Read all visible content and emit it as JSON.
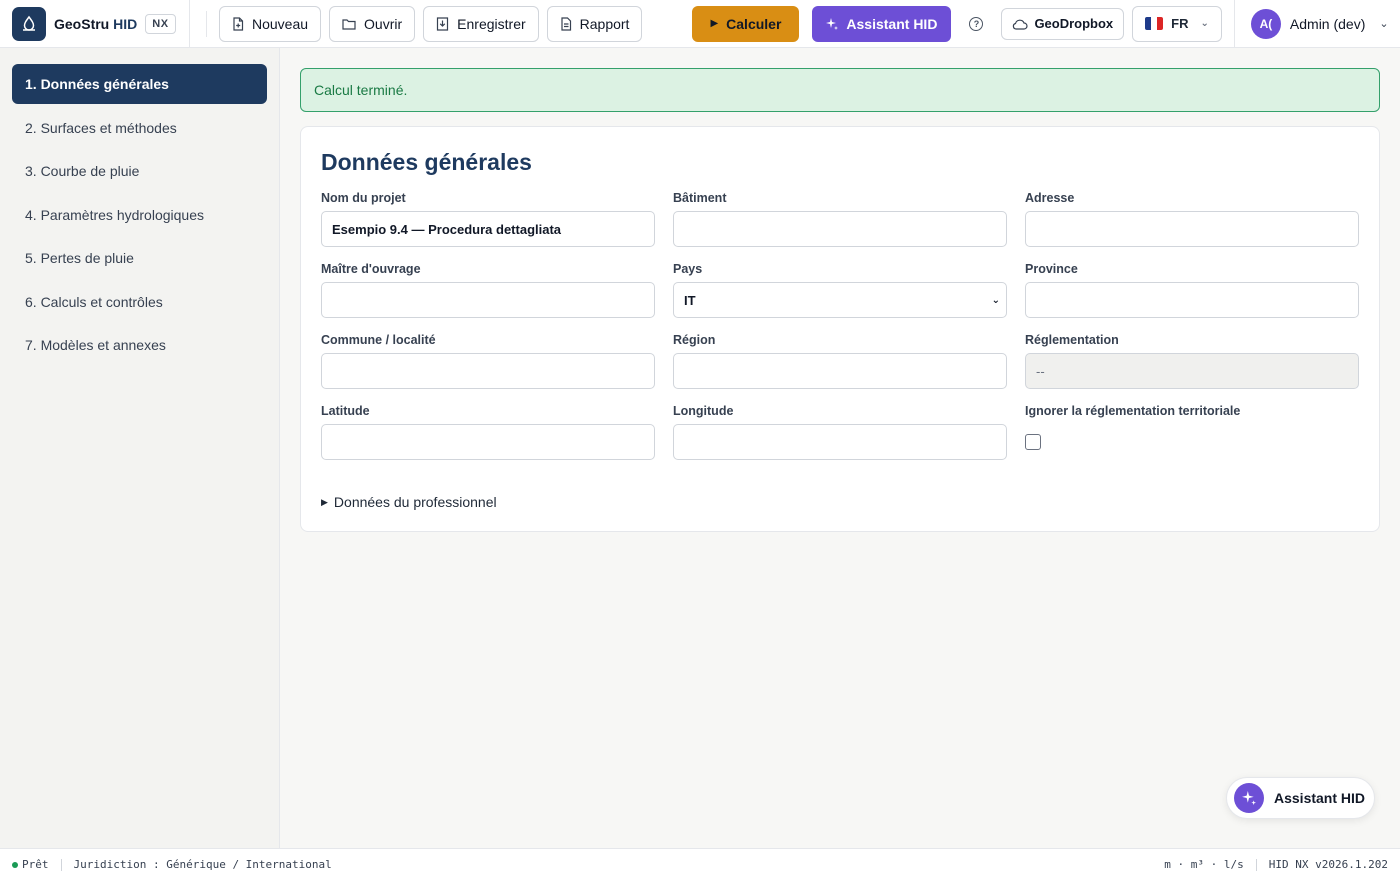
{
  "brand": {
    "name_part1": "GeoStru",
    "name_part2": "HID",
    "badge": "NX"
  },
  "toolbar": {
    "new_label": "Nouveau",
    "open_label": "Ouvrir",
    "save_label": "Enregistrer",
    "report_label": "Rapport",
    "calculate_label": "Calculer",
    "assistant_label": "Assistant HID",
    "help_label": "?",
    "dropbox_label": "GeoDropbox",
    "language": "FR",
    "user_initials": "A(",
    "user_name": "Admin (dev)"
  },
  "sidebar": {
    "items": [
      {
        "label": "1. Données générales",
        "active": true
      },
      {
        "label": "2. Surfaces et méthodes"
      },
      {
        "label": "3. Courbe de pluie"
      },
      {
        "label": "4. Paramètres hydrologiques"
      },
      {
        "label": "5. Pertes de pluie"
      },
      {
        "label": "6. Calculs et contrôles"
      },
      {
        "label": "7. Modèles et annexes"
      }
    ]
  },
  "alert": {
    "message": "Calcul terminé."
  },
  "form": {
    "title": "Données générales",
    "fields": {
      "project_name": {
        "label": "Nom du projet",
        "value": "Esempio 9.4 — Procedura dettagliata"
      },
      "building": {
        "label": "Bâtiment",
        "value": ""
      },
      "address": {
        "label": "Adresse",
        "value": ""
      },
      "client": {
        "label": "Maître d'ouvrage",
        "value": ""
      },
      "country": {
        "label": "Pays",
        "value": "IT"
      },
      "province": {
        "label": "Province",
        "value": ""
      },
      "municipality": {
        "label": "Commune / localité",
        "value": ""
      },
      "region": {
        "label": "Région",
        "value": ""
      },
      "regulation": {
        "label": "Réglementation",
        "value": "--"
      },
      "latitude": {
        "label": "Latitude",
        "value": ""
      },
      "longitude": {
        "label": "Longitude",
        "value": ""
      },
      "ignore_regulation": {
        "label": "Ignorer la réglementation territoriale",
        "checked": false
      }
    },
    "details_label": "Données du professionnel"
  },
  "fab": {
    "label": "Assistant HID"
  },
  "statusbar": {
    "status": "Prêt",
    "jurisdiction": "Juridiction : Générique / International",
    "units": "m · m³ · l/s",
    "version": "HID NX v2026.1.202"
  },
  "colors": {
    "primary": "#1e3a5f",
    "calculate": "#d98e14",
    "assistant": "#6d4fd6",
    "success_bg": "#dcf2e3",
    "success_border": "#34a06b"
  }
}
